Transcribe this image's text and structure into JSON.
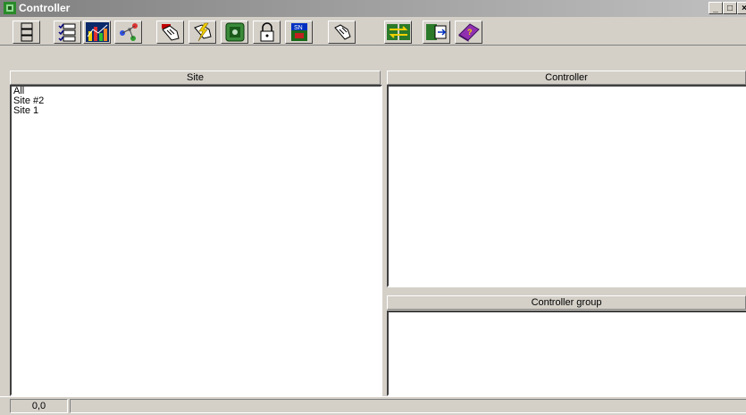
{
  "window": {
    "title": "Controller",
    "buttons": {
      "minimize": "_",
      "maximize": "□",
      "close": "×"
    }
  },
  "toolbar": {
    "buttons": [
      {
        "name": "grid-view-icon"
      },
      {
        "name": "checklist-icon"
      },
      {
        "name": "chart-icon"
      },
      {
        "name": "network-icon"
      },
      {
        "name": "hand-click-icon"
      },
      {
        "name": "lightning-icon"
      },
      {
        "name": "device-icon"
      },
      {
        "name": "lock-icon"
      },
      {
        "name": "sn-card-icon"
      },
      {
        "name": "pointer-hand-icon"
      },
      {
        "name": "transfer-icon"
      },
      {
        "name": "export-icon"
      },
      {
        "name": "help-book-icon"
      }
    ]
  },
  "site_pane": {
    "header": "Site",
    "items": [
      "All",
      "Site #2",
      "Site 1"
    ]
  },
  "controller_pane": {
    "header": "Controller"
  },
  "controller_group_pane": {
    "header": "Controller group"
  },
  "statusbar": {
    "coords": "0,0"
  }
}
